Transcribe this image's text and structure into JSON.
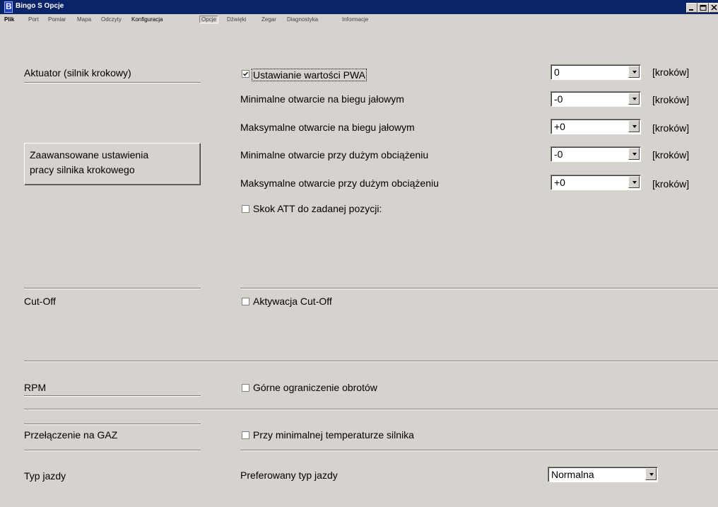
{
  "window": {
    "title": "Bingo S  Opcje"
  },
  "menu": {
    "items": [
      "Plik",
      "Port",
      "Pomiar",
      "Mapa",
      "Odczyty",
      "Konfiguracja",
      "Opcje",
      "Dźwięki",
      "Zegar",
      "Diagnostyka",
      "Informacje"
    ]
  },
  "sections": {
    "actuator": {
      "label": "Aktuator (silnik krokowy)",
      "advanced_button_line1": "Zaawansowane ustawienia",
      "advanced_button_line2": "pracy silnika krokowego",
      "pwa_label": "Ustawianie wartości  PWA",
      "pwa_checked": true,
      "rows": [
        {
          "label": "Minimalne otwarcie na biegu jałowym",
          "value": "-0"
        },
        {
          "label": "Maksymalne otwarcie na biegu jałowym",
          "value": "+0"
        },
        {
          "label": "Minimalne otwarcie przy dużym obciążeniu",
          "value": "-0"
        },
        {
          "label": "Maksymalne otwarcie przy dużym obciążeniu",
          "value": "+0"
        }
      ],
      "pwa_value": "0",
      "unit": "[kroków]",
      "att_label": "Skok ATT do zadanej pozycji:",
      "att_checked": false
    },
    "cutoff": {
      "label": "Cut-Off",
      "option": "Aktywacja Cut-Off",
      "checked": false
    },
    "rpm": {
      "label": "RPM",
      "option": "Górne ograniczenie obrotów",
      "checked": false
    },
    "gas": {
      "label": "Przełączenie na GAZ",
      "option": "Przy minimalnej temperaturze silnika",
      "checked": false
    },
    "drive": {
      "label": "Typ jazdy",
      "option_label": "Preferowany typ jazdy",
      "value": "Normalna"
    }
  }
}
